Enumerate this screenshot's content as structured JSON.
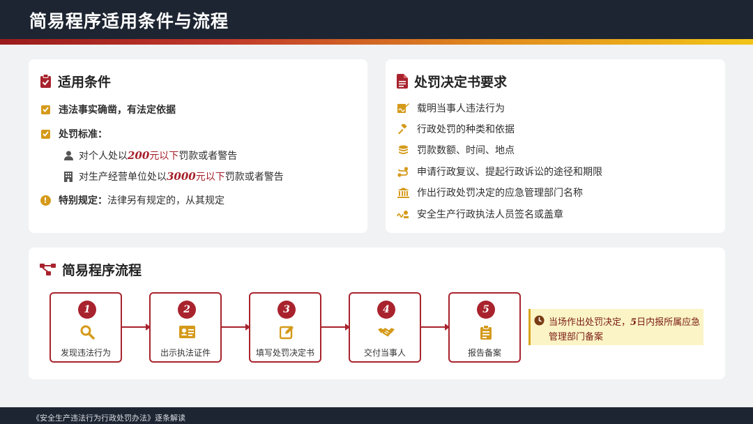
{
  "header": {
    "title": "简易程序适用条件与流程"
  },
  "conditions": {
    "title": "适用条件",
    "item1": "违法事实确凿，有法定依据",
    "item2": "处罚标准：",
    "sub1": {
      "pre": "对个人处以",
      "amount": "200",
      "mid": "元以下",
      "post": "罚款或者警告"
    },
    "sub2": {
      "pre": "对生产经营单位处以",
      "amount": "3000",
      "mid": "元以下",
      "post": "罚款或者警告"
    },
    "special_label": "特别规定：",
    "special_text": "法律另有规定的，从其规定"
  },
  "requirements": {
    "title": "处罚决定书要求",
    "items": [
      "载明当事人违法行为",
      "行政处罚的种类和依据",
      "罚款数额、时间、地点",
      "申请行政复议、提起行政诉讼的途径和期限",
      "作出行政处罚决定的应急管理部门名称",
      "安全生产行政执法人员签名或盖章"
    ]
  },
  "process": {
    "title": "简易程序流程",
    "steps": [
      {
        "num": "1",
        "label": "发现违法行为"
      },
      {
        "num": "2",
        "label": "出示执法证件"
      },
      {
        "num": "3",
        "label": "填写处罚决定书"
      },
      {
        "num": "4",
        "label": "交付当事人"
      },
      {
        "num": "5",
        "label": "报告备案"
      }
    ],
    "note": {
      "pre": "当场作出处罚决定，",
      "days": "5",
      "post": "日内报所属应急管理部门备案"
    }
  },
  "footer": {
    "text": "《安全生产违法行为行政处罚办法》逐条解读"
  },
  "colors": {
    "accent_red": "#a8232d",
    "accent_gold": "#d59a1b",
    "header_bg": "#1d2532"
  }
}
